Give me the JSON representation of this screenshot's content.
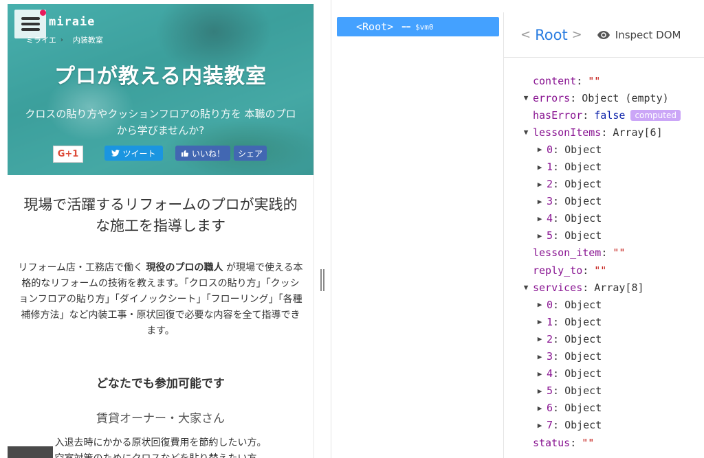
{
  "preview": {
    "brand": "miraie",
    "breadcrumb": [
      "ミライエ",
      "内装教室"
    ],
    "breadcrumb_sep": "›",
    "title": "プロが教える内装教室",
    "subtitle": "クロスの貼り方やクッションフロアの貼り方を 本職のプロから学びませんか?",
    "social": {
      "gplus": "G+1",
      "tweet": "ツイート",
      "like": "いいね！",
      "share": "シェア"
    },
    "lead": "現場で活躍するリフォームのプロが実践的な施工を指導します",
    "desc_pre": "リフォーム店・工務店で働く ",
    "desc_bold": "現役のプロの職人",
    "desc_post": " が現場で使える本格的なリフォームの技術を教えます。「クロスの貼り方」「クッションフロアの貼り方」「ダイノックシート」「フローリング」「各種補修方法」など内装工事・原状回復で必要な内容を全て指導できます。",
    "section_title": "どなたでも参加可能です",
    "section_subtitle": "賃貸オーナー・大家さん",
    "body_line1": "入退去時にかかる原状回復費用を節約したい方。",
    "body_line2": "空室対策のためにクロスなどを貼り替えたい方。"
  },
  "tree": {
    "root_tag": "<Root>",
    "vm": "== $vm0"
  },
  "inspector": {
    "lt": "<",
    "name": "Root",
    "gt": ">",
    "inspect_label": "Inspect DOM",
    "rows": [
      {
        "key": "content",
        "value": "\"\"",
        "type": "str",
        "arrow": "",
        "level": 0
      },
      {
        "key": "errors",
        "value": "Object (empty)",
        "type": "plain",
        "arrow": "▼",
        "level": 0
      },
      {
        "key": "hasError",
        "value": "false",
        "type": "bool",
        "arrow": "",
        "level": 0,
        "badge": "computed"
      },
      {
        "key": "lessonItems",
        "value": "Array[6]",
        "type": "plain",
        "arrow": "▼",
        "level": 0
      },
      {
        "key": "0",
        "value": "Object",
        "type": "plain",
        "arrow": "▶",
        "level": 1
      },
      {
        "key": "1",
        "value": "Object",
        "type": "plain",
        "arrow": "▶",
        "level": 1
      },
      {
        "key": "2",
        "value": "Object",
        "type": "plain",
        "arrow": "▶",
        "level": 1
      },
      {
        "key": "3",
        "value": "Object",
        "type": "plain",
        "arrow": "▶",
        "level": 1
      },
      {
        "key": "4",
        "value": "Object",
        "type": "plain",
        "arrow": "▶",
        "level": 1
      },
      {
        "key": "5",
        "value": "Object",
        "type": "plain",
        "arrow": "▶",
        "level": 1
      },
      {
        "key": "lesson_item",
        "value": "\"\"",
        "type": "str",
        "arrow": "",
        "level": 0
      },
      {
        "key": "reply_to",
        "value": "\"\"",
        "type": "str",
        "arrow": "",
        "level": 0
      },
      {
        "key": "services",
        "value": "Array[8]",
        "type": "plain",
        "arrow": "▼",
        "level": 0
      },
      {
        "key": "0",
        "value": "Object",
        "type": "plain",
        "arrow": "▶",
        "level": 1
      },
      {
        "key": "1",
        "value": "Object",
        "type": "plain",
        "arrow": "▶",
        "level": 1
      },
      {
        "key": "2",
        "value": "Object",
        "type": "plain",
        "arrow": "▶",
        "level": 1
      },
      {
        "key": "3",
        "value": "Object",
        "type": "plain",
        "arrow": "▶",
        "level": 1
      },
      {
        "key": "4",
        "value": "Object",
        "type": "plain",
        "arrow": "▶",
        "level": 1
      },
      {
        "key": "5",
        "value": "Object",
        "type": "plain",
        "arrow": "▶",
        "level": 1
      },
      {
        "key": "6",
        "value": "Object",
        "type": "plain",
        "arrow": "▶",
        "level": 1
      },
      {
        "key": "7",
        "value": "Object",
        "type": "plain",
        "arrow": "▶",
        "level": 1
      },
      {
        "key": "status",
        "value": "\"\"",
        "type": "str",
        "arrow": "",
        "level": 0
      }
    ]
  }
}
